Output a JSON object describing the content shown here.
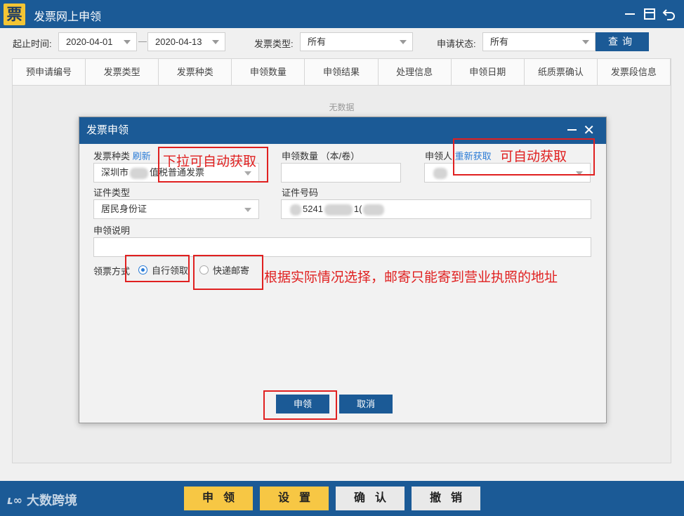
{
  "app": {
    "logo_char": "票",
    "title": "发票网上申领"
  },
  "filters": {
    "date_label": "起止时间:",
    "date_start": "2020-04-01",
    "date_end": "2020-04-13",
    "type_label": "发票类型:",
    "type_value": "所有",
    "status_label": "申请状态:",
    "status_value": "所有",
    "query_label": "查询"
  },
  "table": {
    "columns": [
      "预申请编号",
      "发票类型",
      "发票种类",
      "申领数量",
      "申领结果",
      "处理信息",
      "申领日期",
      "纸质票确认",
      "发票段信息"
    ],
    "empty_text": "无数据"
  },
  "dialog": {
    "title": "发票申领",
    "invoice_kind_label": "发票种类",
    "refresh_link": "刷新",
    "invoice_kind_value_prefix": "深圳市",
    "invoice_kind_value_suffix": "值税普通发票",
    "quantity_label": "申领数量 （本/卷）",
    "quantity_value": "",
    "applicant_label": "申领人",
    "reacquire_link": "重新获取",
    "id_type_label": "证件类型",
    "id_type_value": "居民身份证",
    "id_number_label": "证件号码",
    "id_number_partial": "5241",
    "id_number_tail": "1(",
    "note_label": "申领说明",
    "note_value": "",
    "pickup_label": "领票方式",
    "pickup_options": [
      {
        "label": "自行领取",
        "selected": true
      },
      {
        "label": "快递邮寄",
        "selected": false
      }
    ],
    "submit_label": "申领",
    "cancel_label": "取消"
  },
  "annotations": {
    "dropdown_auto": "下拉可自动获取",
    "applicant_auto": "可自动获取",
    "delivery_note": "根据实际情况选择，邮寄只能寄到营业执照的地址",
    "color": "#e02020"
  },
  "footer": {
    "watermark": "大数跨境",
    "buttons": [
      {
        "label": "申领",
        "style": "yellow"
      },
      {
        "label": "设置",
        "style": "yellow"
      },
      {
        "label": "确认",
        "style": "grey"
      },
      {
        "label": "撤销",
        "style": "grey"
      }
    ]
  },
  "colors": {
    "primary": "#1b5a96",
    "accent_yellow": "#f7c744",
    "link": "#2a7bd6"
  }
}
